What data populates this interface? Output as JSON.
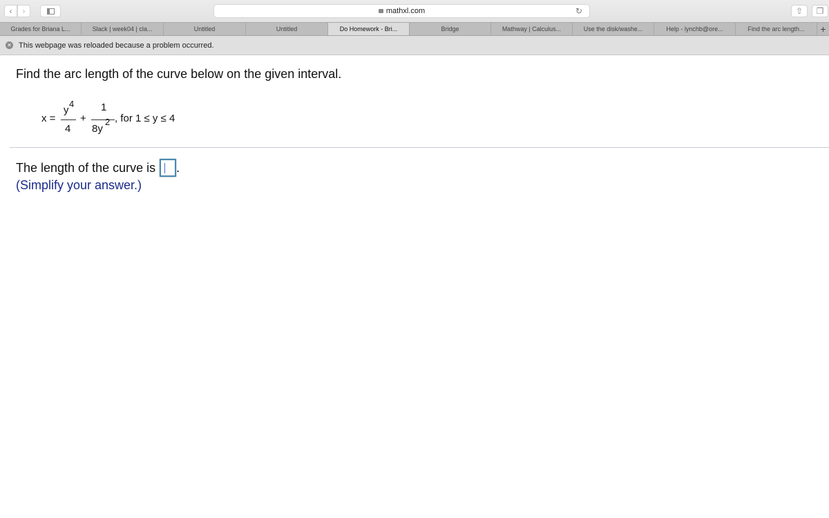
{
  "browser": {
    "url": "mathxl.com",
    "tabs": [
      {
        "label": "Grades for Briana L..."
      },
      {
        "label": "Slack | week04 | cla..."
      },
      {
        "label": "Untitled"
      },
      {
        "label": "Untitled"
      },
      {
        "label": "Do Homework - Bri...",
        "active": true
      },
      {
        "label": "Bridge"
      },
      {
        "label": "Mathway | Calculus..."
      },
      {
        "label": "Use the disk/washe..."
      },
      {
        "label": "Help - lynchb@ore..."
      },
      {
        "label": "Find the arc length..."
      }
    ],
    "new_tab": "+",
    "notice": "This webpage was reloaded because a problem occurred."
  },
  "problem": {
    "prompt": "Find the arc length of the curve below on the given interval.",
    "equation": {
      "lhs": "x =",
      "num1": "y",
      "exp1": "4",
      "den1": "4",
      "plus": "+",
      "num2": "1",
      "den2": "8y",
      "exp2": "2",
      "interval": ", for 1 ≤ y ≤ 4"
    },
    "answer_label": "The length of the curve is",
    "answer_value": "",
    "answer_end": ".",
    "hint": "(Simplify your answer.)"
  }
}
